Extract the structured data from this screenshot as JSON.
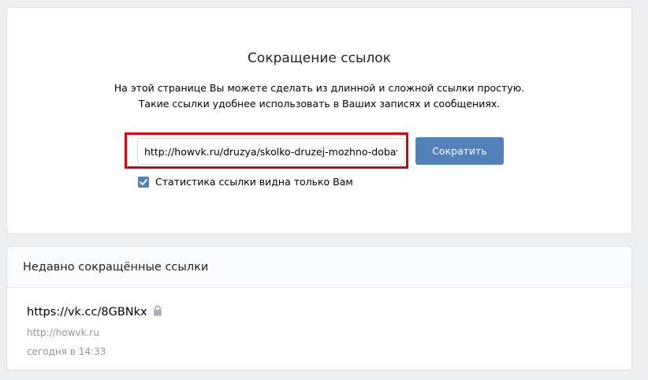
{
  "shortener": {
    "title": "Сокращение ссылок",
    "description_line1": "На этой странице Вы можете сделать из длинной и сложной ссылки простую.",
    "description_line2": "Такие ссылки удобнее использовать в Ваших записях и сообщениях.",
    "input_value": "http://howvk.ru/druzya/skolko-druzej-mozhno-dobavit",
    "button_label": "Сократить",
    "stat_checkbox_checked": true,
    "stat_label": "Статистика ссылки видна только Вам",
    "accent_color": "#5181b8",
    "highlight_color": "#d4000f"
  },
  "recent": {
    "header": "Недавно сокращённые ссылки",
    "items": [
      {
        "short_url": "https://vk.cc/8GBNkx",
        "original_url": "http://howvk.ru",
        "time": "сегодня в 14:33",
        "icon": "lock-icon"
      }
    ]
  }
}
